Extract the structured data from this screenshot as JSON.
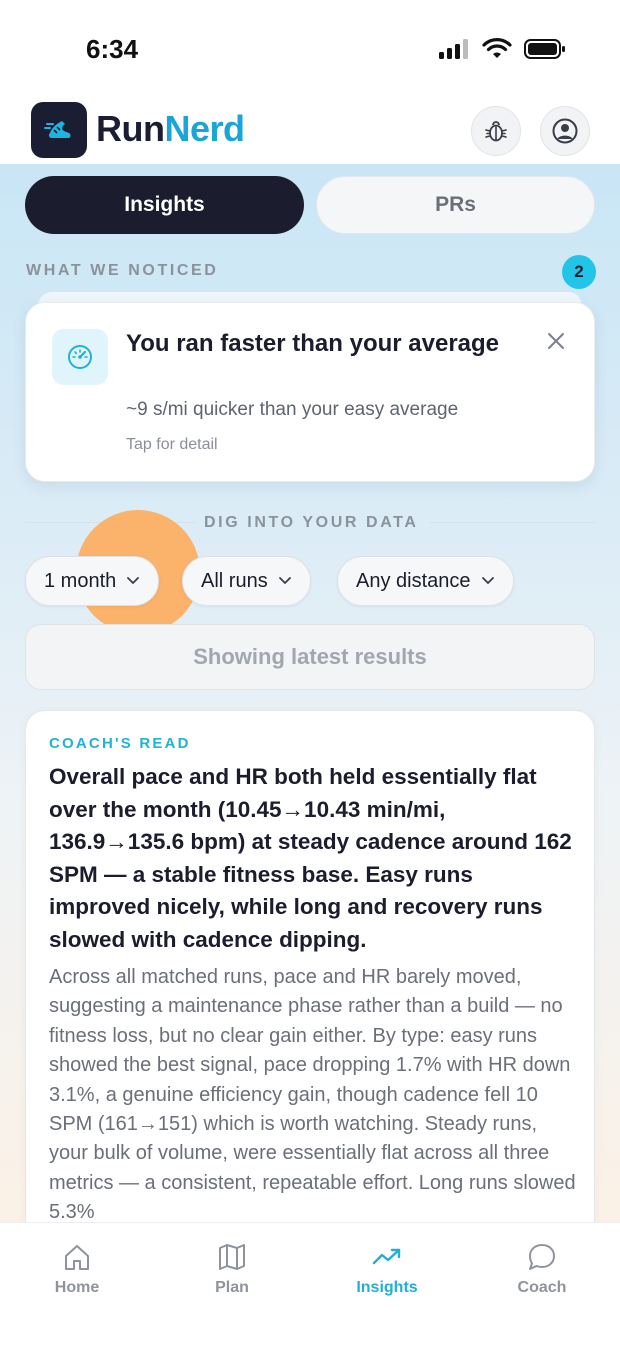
{
  "status_bar": {
    "time": "6:34"
  },
  "header": {
    "logo_part1": "Run",
    "logo_part2": "Nerd",
    "brand_color": "#1aa4d8",
    "bug_icon": "bug-icon",
    "profile_icon": "user-circle-icon"
  },
  "segments": {
    "active": "Insights",
    "inactive": "PRs"
  },
  "noticed": {
    "label": "WHAT WE NOTICED",
    "count": "2",
    "card": {
      "icon": "speedometer-icon",
      "title": "You ran faster than your average",
      "subtitle": "~9 s/mi quicker than your easy average",
      "tap": "Tap for detail"
    }
  },
  "dig": {
    "label": "DIG INTO YOUR DATA",
    "filters": [
      "1 month",
      "All runs",
      "Any distance"
    ],
    "results": "Showing latest results"
  },
  "coach": {
    "label": "COACH'S READ",
    "headline": "Overall pace and HR both held essentially flat over the month (10.45→10.43 min/mi, 136.9→135.6 bpm) at steady cadence around 162 SPM — a stable fitness base. Easy runs improved nicely, while long and recovery runs slowed with cadence dipping.",
    "body": "Across all matched runs, pace and HR barely moved, suggesting a maintenance phase rather than a build — no fitness loss, but no clear gain either. By type: easy runs showed the best signal, pace dropping 1.7% with HR down 3.1%, a genuine efficiency gain, though cadence fell 10 SPM (161→151) which is worth watching. Steady runs, your bulk of volume, were essentially flat across all three metrics — a consistent, repeatable effort. Long runs slowed 5.3%"
  },
  "tabbar": {
    "tabs": [
      {
        "label": "Home",
        "icon": "home-icon"
      },
      {
        "label": "Plan",
        "icon": "map-icon"
      },
      {
        "label": "Insights",
        "icon": "trend-icon"
      },
      {
        "label": "Coach",
        "icon": "chat-icon"
      }
    ],
    "active_color": "#21b0d4"
  }
}
